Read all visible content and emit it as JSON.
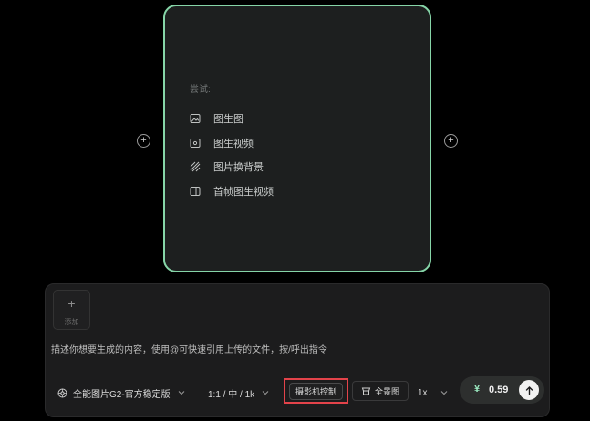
{
  "card": {
    "try_label": "尝试:",
    "items": [
      {
        "label": "图生图",
        "icon": "image-icon"
      },
      {
        "label": "图生视频",
        "icon": "image-video-icon"
      },
      {
        "label": "图片换背景",
        "icon": "hatch-icon"
      },
      {
        "label": "首帧图生视频",
        "icon": "first-frame-icon"
      }
    ]
  },
  "composer": {
    "add_icon": "+",
    "add_label": "添加",
    "placeholder": "描述你想要生成的内容，使用@可快速引用上传的文件，按/呼出指令",
    "model": "全能图片G2-官方稳定版",
    "ratio": "1:1 / 中 / 1k",
    "camera_control": "摄影机控制",
    "full_view": "全景图",
    "multiplier": "1x",
    "currency": "¥",
    "price": "0.59"
  },
  "side_plus": "+",
  "colors": {
    "accent_border": "#86d5a8",
    "highlight": "#e3434a"
  }
}
